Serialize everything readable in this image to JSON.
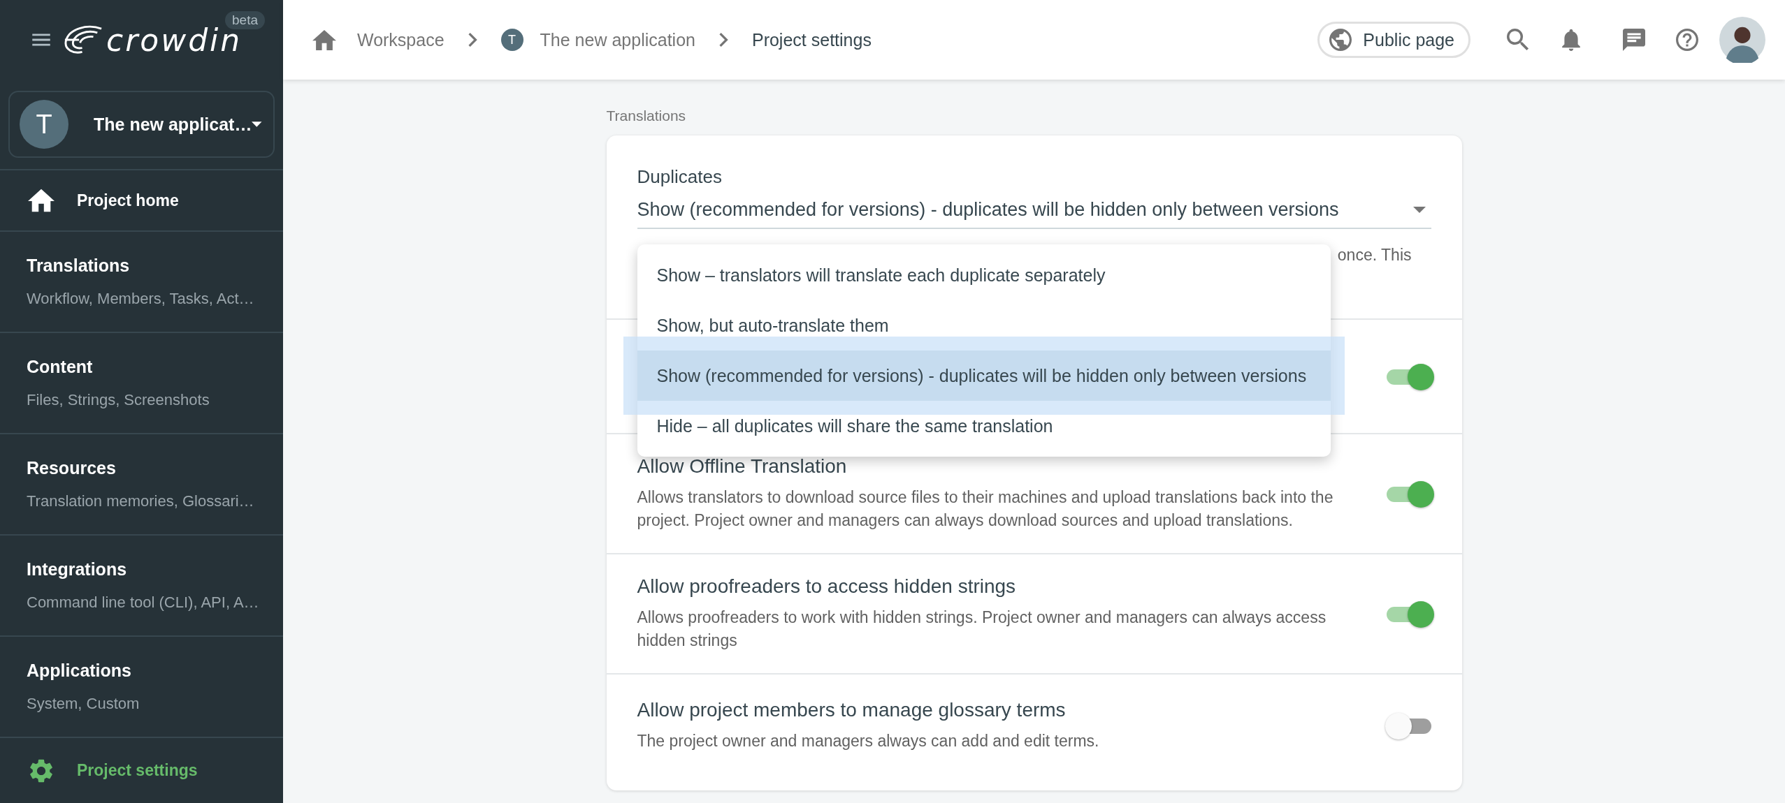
{
  "sidebar": {
    "logo": {
      "text": "crowdin",
      "badge": "beta"
    },
    "project": {
      "initial": "T",
      "name": "The new applicat…"
    },
    "items": [
      {
        "kind": "home",
        "label": "Project home",
        "selected": false
      },
      {
        "kind": "section",
        "label": "Translations",
        "subtitle": "Workflow, Members, Tasks, Act…",
        "selected": false
      },
      {
        "kind": "section",
        "label": "Content",
        "subtitle": "Files, Strings, Screenshots",
        "selected": false
      },
      {
        "kind": "section",
        "label": "Resources",
        "subtitle": "Translation memories, Glossari…",
        "selected": false
      },
      {
        "kind": "section",
        "label": "Integrations",
        "subtitle": "Command line tool (CLI), API, A…",
        "selected": false
      },
      {
        "kind": "section",
        "label": "Applications",
        "subtitle": "System, Custom",
        "selected": false
      },
      {
        "kind": "settings",
        "label": "Project settings",
        "selected": true
      }
    ]
  },
  "header": {
    "breadcrumbs": [
      {
        "kind": "home",
        "label": "Workspace"
      },
      {
        "kind": "project",
        "initial": "T",
        "label": "The new application"
      },
      {
        "kind": "current",
        "label": "Project settings"
      }
    ],
    "public_page": "Public page"
  },
  "section_title": "Translations",
  "card": {
    "duplicates": {
      "label": "Duplicates",
      "value": "Show (recommended for versions) - duplicates will be hidden only between versions",
      "description_visible": "once. This",
      "expanded": true,
      "options": [
        {
          "label": "Show – translators will translate each duplicate separately",
          "selected": false
        },
        {
          "label": "Show, but auto-translate them",
          "selected": false
        },
        {
          "label": "Show (recommended for versions) - duplicates will be hidden only between versions",
          "selected": true
        },
        {
          "label": "Hide – all duplicates will share the same translation",
          "selected": false
        }
      ]
    },
    "toggles": [
      {
        "on": true
      },
      {
        "title": "Allow Offline Translation",
        "description": "Allows translators to download source files to their machines and upload translations back into the project. Project owner and managers can always download sources and upload translations.",
        "on": true
      },
      {
        "title": "Allow proofreaders to access hidden strings",
        "description": "Allows proofreaders to work with hidden strings. Project owner and managers can always access hidden strings",
        "on": true
      },
      {
        "title": "Allow project members to manage glossary terms",
        "description": "The project owner and managers always can add and edit terms.",
        "on": false
      }
    ]
  }
}
